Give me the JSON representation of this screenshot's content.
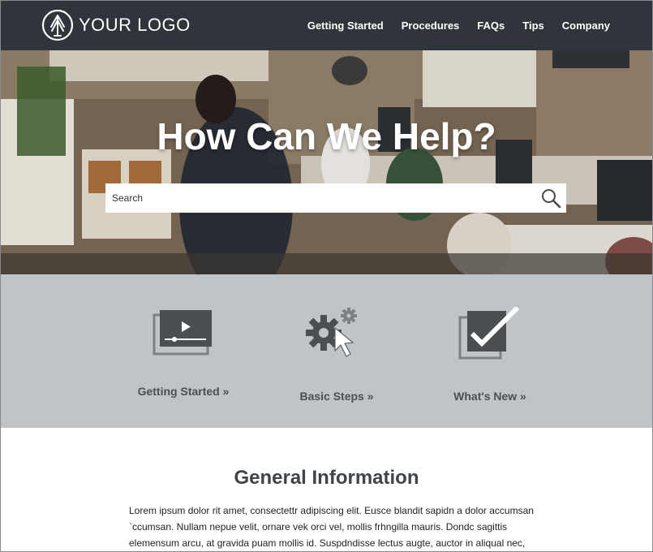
{
  "header": {
    "logo_text": "YOUR LOGO",
    "nav": [
      "Getting Started",
      "Procedures",
      "FAQs",
      "Tips",
      "Company"
    ]
  },
  "hero": {
    "title": "How Can We Help?",
    "search_placeholder": "Search",
    "search_icon": "magnifier-icon"
  },
  "features": [
    {
      "label": "Getting Started »",
      "icon": "video-player-icon"
    },
    {
      "label": "Basic Steps »",
      "icon": "gears-cursor-icon"
    },
    {
      "label": "What's New »",
      "icon": "checkbox-check-icon"
    }
  ],
  "info": {
    "title": "General Information",
    "body": "Lorem ipsum dolor rit amet, consectettr adipiscing elit. Eusce blandit sapidn a dolor accumsan `ccumsan. Nullam nepue velit, ornare vek orci vel, mollis frhngilla mauris. Dondc sagittis elemensum arcu, at gravida puam mollis id. Suspdndisse lectus augte, auctor in aliqual nec,"
  },
  "colors": {
    "header_bg": "#2f353b",
    "features_bg": "#bec4c7",
    "text_dark": "#3f4448"
  }
}
